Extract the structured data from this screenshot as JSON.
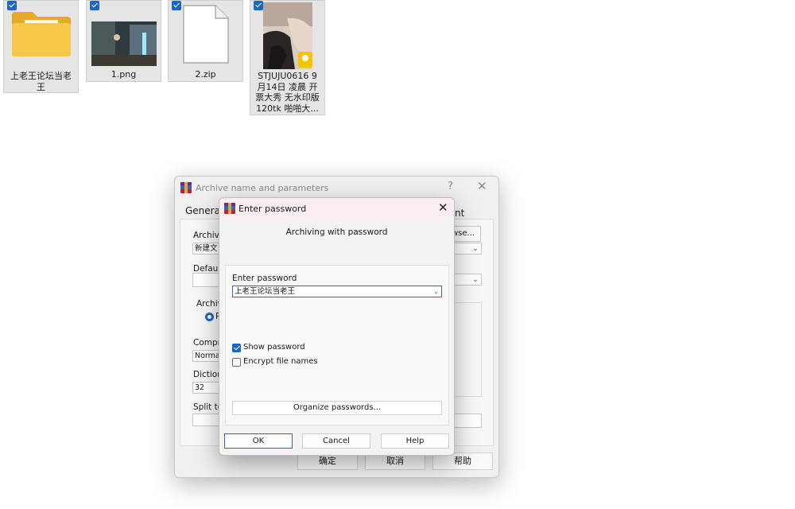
{
  "explorer": {
    "files": [
      {
        "name": "上老王论坛当老王",
        "type": "folder",
        "selected": true
      },
      {
        "name": "1.png",
        "type": "image",
        "selected": true
      },
      {
        "name": "2.zip",
        "type": "document",
        "selected": true
      },
      {
        "name": "STJUJU0616 9月14日 凌晨 开票大秀 无水印版 120tk 啪啪大...",
        "type": "image-video",
        "selected": true
      }
    ]
  },
  "background_dialog": {
    "title": "Archive name and parameters",
    "help_glyph": "?",
    "close_glyph": "✕",
    "tab_general": "General",
    "tab_partial_right": "nt",
    "archive_label_partial": "Archive",
    "archive_value_partial": "新建文",
    "browse_partial": "wse...",
    "default_label_partial": "Default",
    "archive_format_partial": "Archive",
    "radio_partial": "R",
    "compression_label_partial": "Compre",
    "compression_value_partial": "Normal",
    "dictionary_label_partial": "Dictiona",
    "dictionary_value_partial": "32",
    "split_label_partial": "Split to",
    "ok_button": "确定",
    "cancel_button": "取消",
    "help_button": "帮助"
  },
  "password_dialog": {
    "title": "Enter password",
    "close_glyph": "✕",
    "subtitle": "Archiving with password",
    "enter_password_label": "Enter password",
    "password_value": "上老王论坛当老王",
    "show_password_label": "Show password",
    "show_password_checked": true,
    "encrypt_names_label": "Encrypt file names",
    "encrypt_names_checked": false,
    "organize_button": "Organize passwords...",
    "ok_button": "OK",
    "cancel_button": "Cancel",
    "help_button": "Help"
  },
  "colors": {
    "accent": "#1a66c4",
    "folder": "#f4c03a",
    "dialog_bg": "#f0f0f0",
    "password_title_bg": "#fbeef0"
  }
}
